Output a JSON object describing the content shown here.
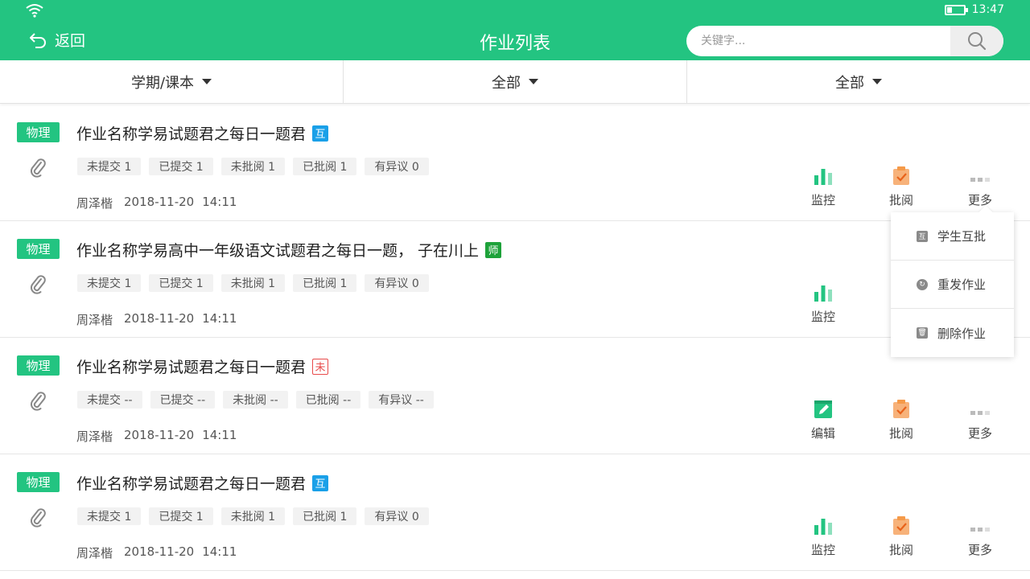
{
  "status_bar": {
    "time": "13:47"
  },
  "header": {
    "back_label": "返回",
    "title": "作业列表",
    "search_placeholder": "关键字..."
  },
  "filters": [
    {
      "label": "学期/课本"
    },
    {
      "label": "全部"
    },
    {
      "label": "全部"
    }
  ],
  "items": [
    {
      "subject": "物理",
      "title": "作业名称学易试题君之每日一题君",
      "tag": "互",
      "stats": [
        "未提交 1",
        "已提交 1",
        "未批阅 1",
        "已批阅 1",
        "有异议 0"
      ],
      "author": "周泽楷",
      "date": "2018-11-20",
      "time": "14:11",
      "actions": [
        "监控",
        "批阅",
        "更多"
      ]
    },
    {
      "subject": "物理",
      "title": "作业名称学易高中一年级语文试题君之每日一题， 子在川上",
      "tag": "师",
      "stats": [
        "未提交 1",
        "已提交 1",
        "未批阅 1",
        "已批阅 1",
        "有异议 0"
      ],
      "author": "周泽楷",
      "date": "2018-11-20",
      "time": "14:11",
      "actions": [
        "监控"
      ]
    },
    {
      "subject": "物理",
      "title": "作业名称学易试题君之每日一题君",
      "tag": "未",
      "stats": [
        "未提交 --",
        "已提交 --",
        "未批阅 --",
        "已批阅 --",
        "有异议 --"
      ],
      "author": "周泽楷",
      "date": "2018-11-20",
      "time": "14:11",
      "actions": [
        "编辑",
        "批阅",
        "更多"
      ]
    },
    {
      "subject": "物理",
      "title": "作业名称学易试题君之每日一题君",
      "tag": "互",
      "stats": [
        "未提交 1",
        "已提交 1",
        "未批阅 1",
        "已批阅 1",
        "有异议 0"
      ],
      "author": "周泽楷",
      "date": "2018-11-20",
      "time": "14:11",
      "actions": [
        "监控",
        "批阅",
        "更多"
      ]
    }
  ],
  "more_menu": {
    "items": [
      {
        "icon": "peer-review-icon",
        "label": "学生互批",
        "glyph": "互"
      },
      {
        "icon": "refresh-icon",
        "label": "重发作业",
        "glyph": "↻"
      },
      {
        "icon": "trash-icon",
        "label": "删除作业",
        "glyph": "🗑"
      }
    ]
  },
  "colors": {
    "primary": "#23c481",
    "tag_hu": "#1aa0e8",
    "tag_shi": "#1ea23a",
    "tag_wei": "#e84a4a",
    "review_orange": "#f59a49"
  }
}
